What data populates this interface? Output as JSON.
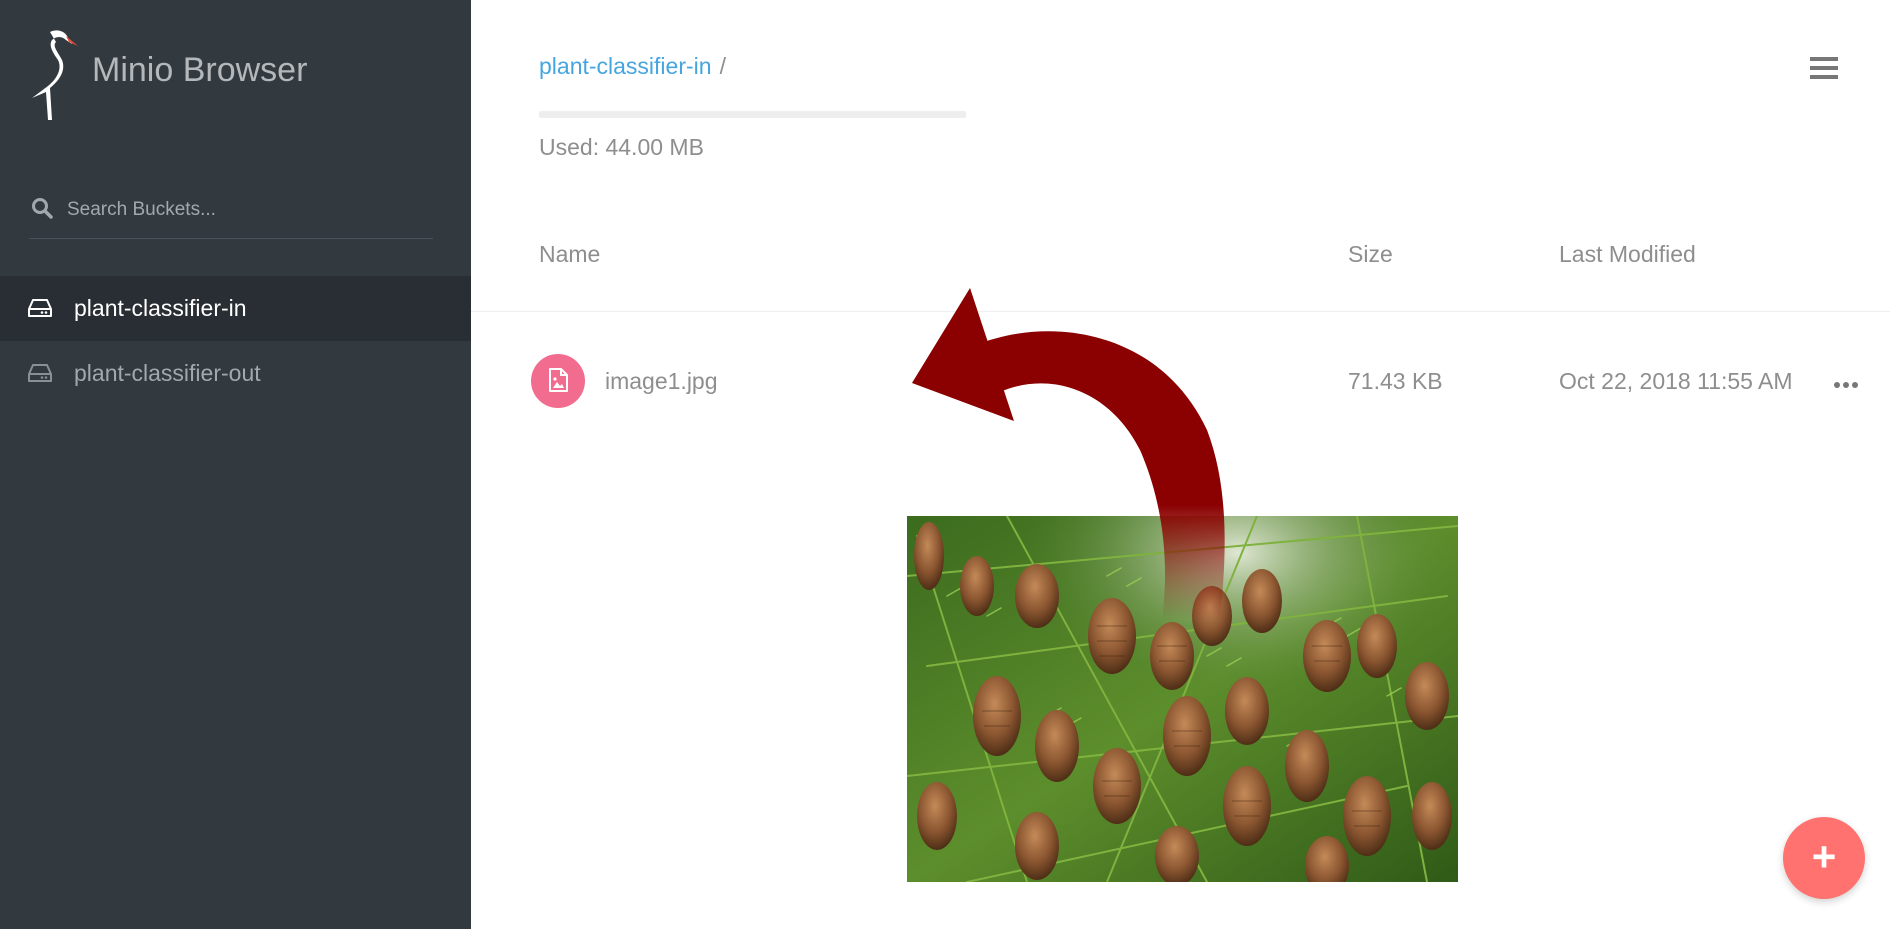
{
  "app": {
    "title": "Minio Browser"
  },
  "sidebar": {
    "search_placeholder": "Search Buckets...",
    "buckets": [
      {
        "label": "plant-classifier-in",
        "active": true
      },
      {
        "label": "plant-classifier-out",
        "active": false
      }
    ]
  },
  "header": {
    "breadcrumb": {
      "bucket": "plant-classifier-in",
      "separator": "/"
    },
    "usage_fraction": 0.0,
    "used_text": "Used: 44.00 MB"
  },
  "table": {
    "columns": {
      "name": "Name",
      "size": "Size",
      "last_modified": "Last Modified"
    },
    "rows": [
      {
        "name": "image1.jpg",
        "size": "71.43 KB",
        "last_modified": "Oct 22, 2018 11:55 AM",
        "icon": "image-file-icon"
      }
    ]
  },
  "fab": {
    "label": "+"
  },
  "colors": {
    "sidebar_bg": "#32393f",
    "sidebar_active_bg": "#282e33",
    "link": "#46a5e0",
    "file_icon": "#f26c8f",
    "fab": "#ff726f",
    "annotation_arrow": "#8b0000"
  }
}
